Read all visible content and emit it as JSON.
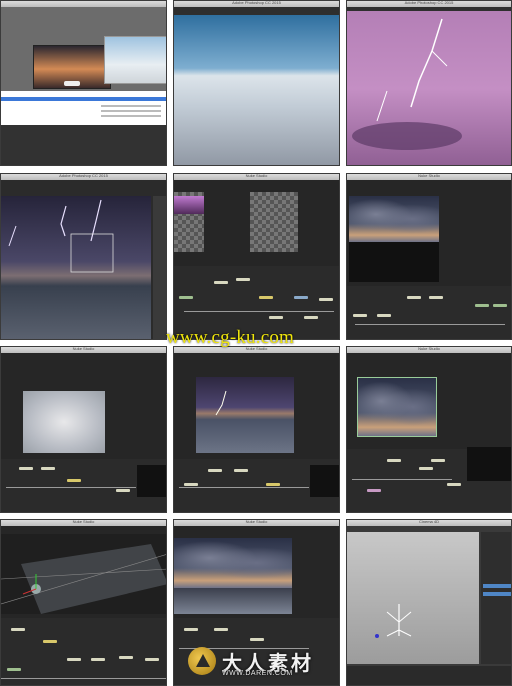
{
  "thumbnails": [
    {
      "id": 1,
      "title": "",
      "desc": "file browser"
    },
    {
      "id": 2,
      "title": "Adobe Photoshop CC 2015",
      "desc": "salt flat photo"
    },
    {
      "id": 3,
      "title": "Adobe Photoshop CC 2015",
      "desc": "purple lightning"
    },
    {
      "id": 4,
      "title": "Adobe Photoshop CC 2015",
      "desc": "storm lightning composite"
    },
    {
      "id": 5,
      "title": "Nuke Studio",
      "desc": "node graph"
    },
    {
      "id": 6,
      "title": "Nuke Studio",
      "desc": "cloudy sky composite"
    },
    {
      "id": 7,
      "title": "Nuke Studio",
      "desc": "cloud fog plate"
    },
    {
      "id": 8,
      "title": "Nuke Studio",
      "desc": "lightning over salt flats"
    },
    {
      "id": 9,
      "title": "Nuke Studio",
      "desc": "sky plate"
    },
    {
      "id": 10,
      "title": "Nuke Studio",
      "desc": "3d camera view"
    },
    {
      "id": 11,
      "title": "Nuke Studio",
      "desc": "cloud sky final"
    },
    {
      "id": 12,
      "title": "Cinema 4D",
      "desc": "3d viewport"
    }
  ],
  "watermark_text": "www.cg-ku.com",
  "logo": {
    "name": "大人素材",
    "url": "WWW.DAREN.COM"
  },
  "colors": {
    "accent": "#f0e60c",
    "ui_dark": "#262626"
  }
}
